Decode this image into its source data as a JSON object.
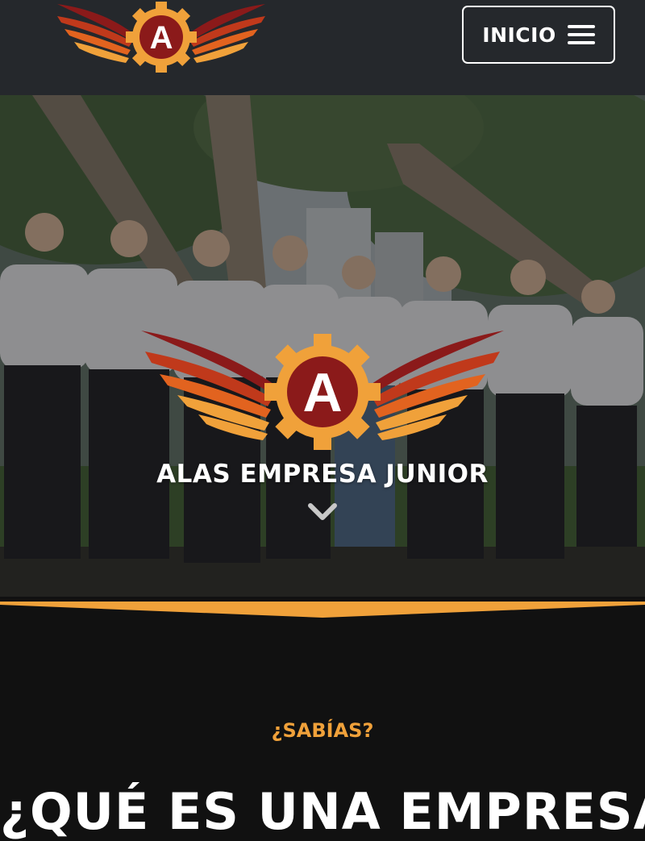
{
  "header": {
    "menu_label": "INICIO",
    "logo_letter": "A"
  },
  "hero": {
    "title": "ALAS EMPRESA JUNIOR",
    "logo_letter": "A"
  },
  "section": {
    "kicker": "¿SABÍAS?",
    "title": "¿QUÉ ES UNA EMPRESA"
  },
  "icons": {
    "menu": "hamburger-icon",
    "scroll": "chevron-down-icon"
  },
  "colors": {
    "header_bg": "#25282c",
    "accent_orange": "#f0a13a",
    "logo_red": "#8b1a1a",
    "page_bg": "#111111"
  }
}
